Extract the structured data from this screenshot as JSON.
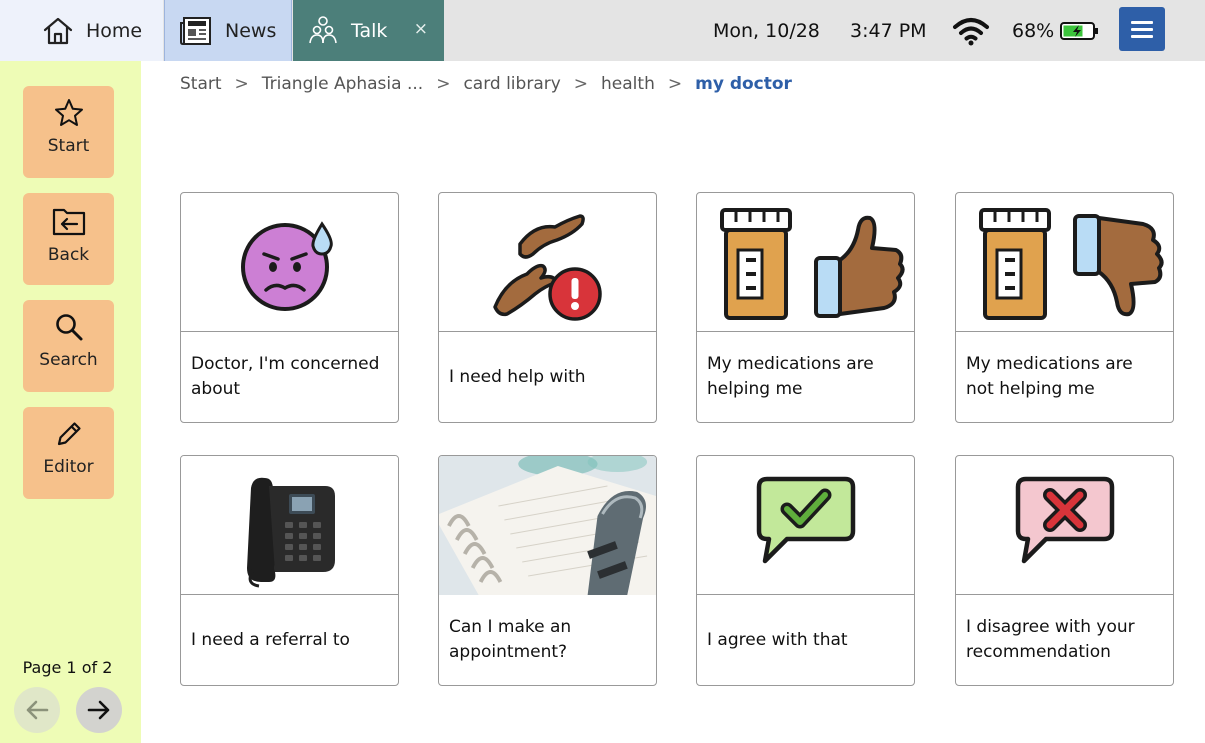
{
  "tabs": [
    {
      "label": "Home",
      "icon": "home-icon"
    },
    {
      "label": "News",
      "icon": "newspaper-icon"
    },
    {
      "label": "Talk",
      "icon": "talk-people-icon",
      "close": "×"
    }
  ],
  "status": {
    "date": "Mon, 10/28",
    "time": "3:47 PM",
    "battery": "68%",
    "battery_level": 0.68,
    "wifi_icon": "wifi-icon",
    "menu_icon": "hamburger-menu-icon"
  },
  "colors": {
    "accent": "#2e5fa8",
    "sidebar_bg": "#eefcb6",
    "sidebar_button": "#f6c18b",
    "talk_tab": "#4c7f7a",
    "news_tab": "#c8d8f2"
  },
  "sidebar": {
    "buttons": [
      {
        "label": "Start",
        "icon": "star-icon"
      },
      {
        "label": "Back",
        "icon": "back-folder-icon"
      },
      {
        "label": "Search",
        "icon": "search-icon"
      },
      {
        "label": "Editor",
        "icon": "pencil-icon"
      }
    ],
    "page_label": "Page 1 of 2",
    "prev_icon": "arrow-left-icon",
    "next_icon": "arrow-right-icon"
  },
  "breadcrumb": {
    "items": [
      "Start",
      "Triangle Aphasia ...",
      "card library",
      "health"
    ],
    "separator": ">",
    "current": "my doctor"
  },
  "cards": [
    {
      "label": "Doctor, I'm concerned about",
      "icon": "worried-face-icon"
    },
    {
      "label": "I need help with",
      "icon": "helping-hands-icon"
    },
    {
      "label": "My medications are helping me",
      "icon": "medication-thumbs-up-icon"
    },
    {
      "label": "My medications are not helping me",
      "icon": "medication-thumbs-down-icon"
    },
    {
      "label": "I need a referral to",
      "icon": "desk-phone-image"
    },
    {
      "label": "Can I make an appointment?",
      "icon": "planner-image"
    },
    {
      "label": "I agree with that",
      "icon": "speech-check-icon"
    },
    {
      "label": "I disagree with your recommendation",
      "icon": "speech-x-icon"
    }
  ]
}
